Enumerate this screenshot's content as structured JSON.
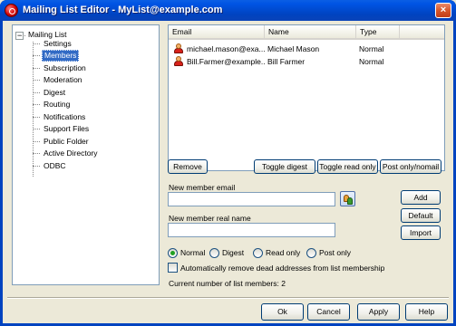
{
  "window": {
    "title": "Mailing List Editor - MyList@example.com",
    "close_glyph": "×"
  },
  "tree": {
    "root": "Mailing List",
    "expander": "−",
    "items": [
      {
        "label": "Settings",
        "selected": false
      },
      {
        "label": "Members",
        "selected": true
      },
      {
        "label": "Subscription",
        "selected": false
      },
      {
        "label": "Moderation",
        "selected": false
      },
      {
        "label": "Digest",
        "selected": false
      },
      {
        "label": "Routing",
        "selected": false
      },
      {
        "label": "Notifications",
        "selected": false
      },
      {
        "label": "Support Files",
        "selected": false
      },
      {
        "label": "Public Folder",
        "selected": false
      },
      {
        "label": "Active Directory",
        "selected": false
      },
      {
        "label": "ODBC",
        "selected": false
      }
    ]
  },
  "members": {
    "columns": [
      "Email",
      "Name",
      "Type"
    ],
    "rows": [
      {
        "email": "michael.mason@exa...",
        "name": "Michael Mason",
        "type": "Normal",
        "icon": "person-icon"
      },
      {
        "email": "Bill.Farmer@example...",
        "name": "Bill Farmer",
        "type": "Normal",
        "icon": "person-icon"
      }
    ]
  },
  "list_buttons": {
    "remove": "Remove",
    "toggle_digest": "Toggle digest",
    "toggle_read_only": "Toggle read only",
    "post_only": "Post only/nomail"
  },
  "form": {
    "email_label": "New member email",
    "email_value": "",
    "realname_label": "New member real name",
    "realname_value": "",
    "add": "Add",
    "default": "Default",
    "import": "Import"
  },
  "member_type": {
    "options": [
      "Normal",
      "Digest",
      "Read only",
      "Post only"
    ],
    "selected": "Normal"
  },
  "auto_remove": {
    "label": "Automatically remove dead addresses from list membership",
    "checked": false
  },
  "count_text": "Current number of list members: 2",
  "dialog_buttons": {
    "ok": "Ok",
    "cancel": "Cancel",
    "apply": "Apply",
    "help": "Help"
  },
  "colors": {
    "title_bar": "#0054e3",
    "selection": "#316ac5",
    "dialog_bg": "#ece9d8"
  }
}
